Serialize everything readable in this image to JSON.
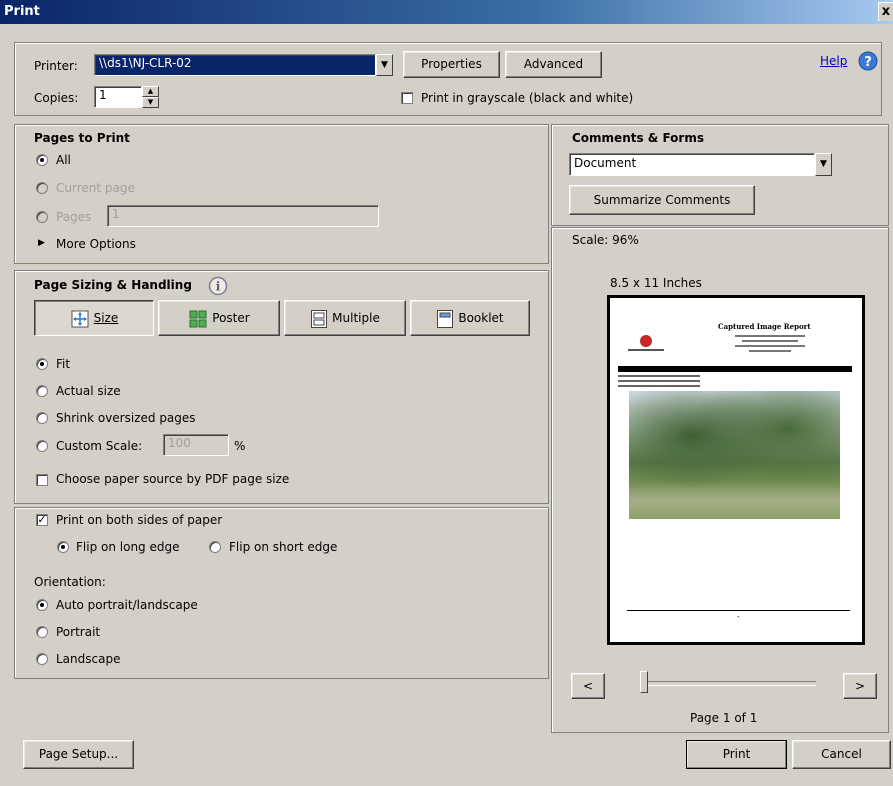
{
  "window": {
    "title": "Print",
    "close_glyph": "x"
  },
  "top": {
    "printer_label": "Printer:",
    "printer_value": "\\\\ds1\\NJ-CLR-02",
    "properties_label": "Properties",
    "advanced_label": "Advanced",
    "help_label": "Help",
    "copies_label": "Copies:",
    "copies_value": "1",
    "grayscale_label": "Print in grayscale (black and white)"
  },
  "pages_to_print": {
    "title": "Pages to Print",
    "all_label": "All",
    "current_label": "Current page",
    "pages_label": "Pages",
    "pages_value": "1",
    "more_options_label": "More Options"
  },
  "sizing": {
    "title": "Page Sizing & Handling",
    "size_label": "Size",
    "poster_label": "Poster",
    "multiple_label": "Multiple",
    "booklet_label": "Booklet",
    "fit_label": "Fit",
    "actual_label": "Actual size",
    "shrink_label": "Shrink oversized pages",
    "custom_label": "Custom Scale:",
    "custom_value": "100",
    "percent": "%",
    "paper_source_label": "Choose paper source by PDF page size"
  },
  "duplex": {
    "both_sides_label": "Print on both sides of paper",
    "long_edge_label": "Flip on long edge",
    "short_edge_label": "Flip on short edge",
    "orientation_label": "Orientation:",
    "auto_label": "Auto portrait/landscape",
    "portrait_label": "Portrait",
    "landscape_label": "Landscape"
  },
  "comments": {
    "title": "Comments & Forms",
    "select_value": "Document",
    "summarize_label": "Summarize Comments"
  },
  "preview": {
    "scale": "Scale: 96%",
    "paper": "8.5 x 11 Inches",
    "doc_title": "Captured Image Report",
    "prev_label": "<",
    "next_label": ">",
    "page_indicator": "Page 1 of 1",
    "footer_dash": "-"
  },
  "footer": {
    "page_setup_label": "Page Setup...",
    "print_label": "Print",
    "cancel_label": "Cancel"
  }
}
